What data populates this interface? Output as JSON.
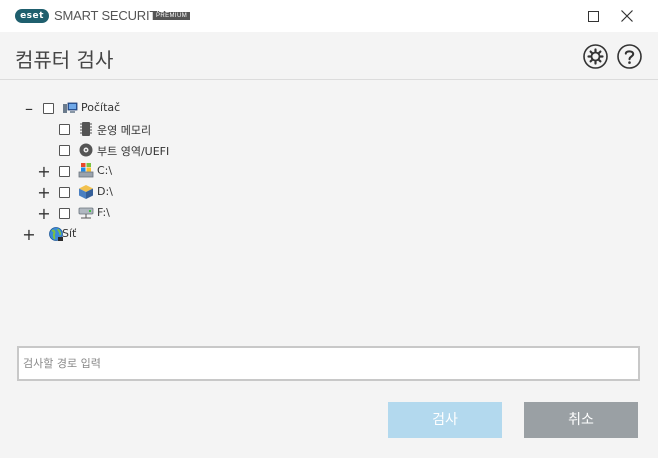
{
  "window": {
    "logo_text": "eset",
    "product_name": "SMART SECURITY",
    "edition_badge": "PREMIUM",
    "maximize_icon": "maximize-icon",
    "close_icon": "close-icon"
  },
  "header": {
    "title": "컴퓨터 검사",
    "settings_icon": "gear-icon",
    "help_icon": "help-icon"
  },
  "tree": {
    "root": {
      "label": "Počítač",
      "toggle": "–",
      "icon": "computer-icon",
      "checked": false,
      "expanded": true
    },
    "children": [
      {
        "label": "운영 메모리",
        "toggle": "",
        "icon": "memory-icon",
        "checked": false
      },
      {
        "label": "부트 영역/UEFI",
        "toggle": "",
        "icon": "disc-icon",
        "checked": false
      },
      {
        "label": "C:\\",
        "toggle": "+",
        "icon": "windows-drive-icon",
        "checked": false
      },
      {
        "label": "D:\\",
        "toggle": "+",
        "icon": "package-drive-icon",
        "checked": false
      },
      {
        "label": "F:\\",
        "toggle": "+",
        "icon": "network-drive-icon",
        "checked": false
      }
    ],
    "network": {
      "label": "Síť",
      "toggle": "+",
      "icon": "globe-icon"
    }
  },
  "path_input": {
    "value": "",
    "placeholder": "검사할 경로 입력"
  },
  "buttons": {
    "scan_label": "검사",
    "cancel_label": "취소"
  },
  "colors": {
    "scan_button": "#b3d9ee",
    "cancel_button": "#9aa0a4",
    "logo_bg": "#1f5f6e",
    "background": "#f4f4f4"
  }
}
